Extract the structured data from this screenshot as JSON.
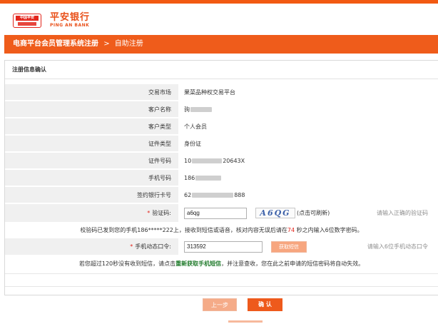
{
  "brand": {
    "badge_text": "中国平安",
    "name_cn": "平安银行",
    "name_en": "PING AN BANK"
  },
  "breadcrumb": {
    "system": "电商平台会员管理系统注册",
    "separator": ">",
    "current": "自助注册"
  },
  "section": {
    "title": "注册信息确认"
  },
  "fields": {
    "market": {
      "label": "交易市场",
      "value": "果菜品种权交易平台"
    },
    "customer_name": {
      "label": "客户名称",
      "value": "驹"
    },
    "customer_type": {
      "label": "客户类型",
      "value": "个人会员"
    },
    "id_type": {
      "label": "证件类型",
      "value": "身份证"
    },
    "id_number": {
      "label": "证件号码",
      "prefix": "10",
      "suffix": "20643X"
    },
    "phone": {
      "label": "手机号码",
      "prefix": "186"
    },
    "bank_card": {
      "label": "签约银行卡号",
      "prefix": "62",
      "suffix": "888"
    }
  },
  "captcha_row": {
    "required_mark": "*",
    "label": "验证码:",
    "input_value": "a6qg",
    "captcha_text": "A6QG",
    "captcha_hint": "(点击可刷新)",
    "side_hint": "请输入正确的验证码"
  },
  "sms_notice": {
    "before": "校验码已发到您的手机186*****222上，接收到短信或语音，核对内容无误后请在",
    "seconds": "74",
    "after": "秒之内输入6位数字密码。"
  },
  "dynamic_pwd_row": {
    "required_mark": "*",
    "label": "手机动态口令:",
    "input_value": "313592",
    "button_label": "获取短信",
    "side_hint": "请输入6位手机动态口令"
  },
  "resend_notice": {
    "before": "若您超过120秒没有收到短信，请点击",
    "link": "重新获取手机短信",
    "after": "，并注意查收，您在此之前申请的短信密码将自动失效。"
  },
  "actions": {
    "prev_label": "上一步",
    "confirm_label": "确 认"
  },
  "colors": {
    "brand_orange": "#ef5c1b",
    "brand_red": "#e3241b",
    "link_green": "#1f7a2a"
  }
}
